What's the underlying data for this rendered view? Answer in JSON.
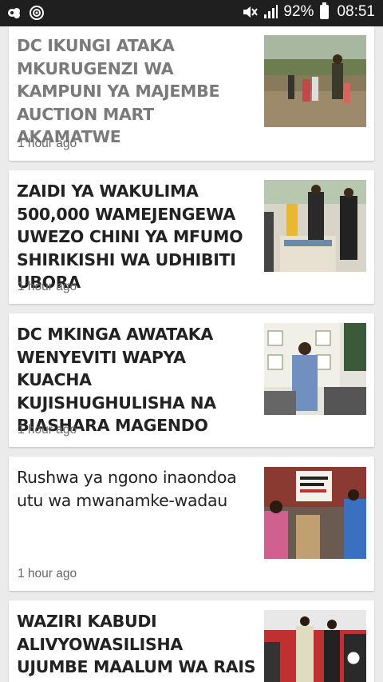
{
  "status_bar": {
    "battery_percent": "92%",
    "time": "08:51",
    "icons": [
      "notification-icon",
      "camera-app-icon",
      "mute-icon",
      "signal-icon",
      "battery-icon"
    ]
  },
  "feed": {
    "articles": [
      {
        "title": "DC IKUNGI ATAKA MKURUGENZI WA KAMPUNI YA MAJEMBE AUCTION MART AKAMATWE",
        "time": "1 hour ago",
        "thumbnail": "people-in-dry-field-photo"
      },
      {
        "title": "ZAIDI YA WAKULIMA 500,000 WAMEJENGEWA UWEZO CHINI YA MFUMO SHIRIKISHI WA UDHIBITI UBORA",
        "time": "1 hour ago",
        "thumbnail": "officials-at-exhibition-table-photo"
      },
      {
        "title": "DC MKINGA AWATAKA WENYEVITI WAPYA KUACHA KUJISHUGHULISHA NA BIASHARA MAGENDO",
        "time": "1 hour ago",
        "thumbnail": "man-speaking-microphone-photo"
      },
      {
        "title": "Rushwa ya ngono inaondoa utu wa mwanamke-wadau",
        "time": "1 hour ago",
        "thumbnail": "women-holding-placards-photo"
      },
      {
        "title": "WAZIRI KABUDI ALIVYOWASILISHA UJUMBE MAALUM WA RAIS",
        "time": "",
        "thumbnail": "officials-greeting-state-house-photo"
      }
    ]
  }
}
